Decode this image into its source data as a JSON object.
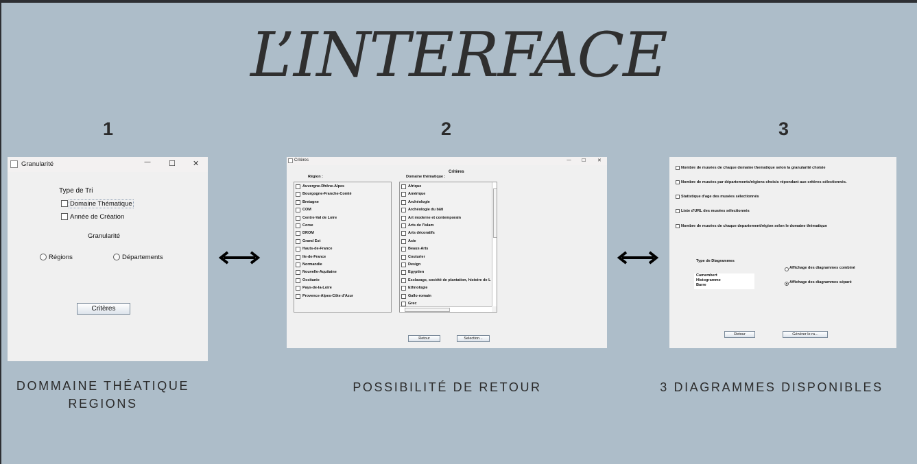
{
  "title": "L’INTERFACE",
  "sections": [
    {
      "number": "1",
      "caption_lines": [
        "DOMMAINE THÉATIQUE",
        "REGIONS"
      ]
    },
    {
      "number": "2",
      "caption_lines": [
        "POSSIBILITÉ DE RETOUR"
      ]
    },
    {
      "number": "3",
      "caption_lines": [
        "3 DIAGRAMMES DISPONIBLES"
      ]
    }
  ],
  "window1": {
    "title": "Granularité",
    "controls": {
      "minimize": "—",
      "maximize": "☐",
      "close": "✕"
    },
    "type_tri_label": "Type de Tri",
    "type_tri_options": [
      "Domaine Thématique",
      "Année de Création"
    ],
    "granularite_label": "Granularité",
    "granularite_options": [
      "Régions",
      "Départements"
    ],
    "button": "Critères"
  },
  "window2": {
    "title": "Critères",
    "controls": {
      "minimize": "—",
      "maximize": "☐",
      "close": "✕"
    },
    "heading": "Critères",
    "region_label": "Région :",
    "domaine_label": "Domaine thématique :",
    "regions": [
      "Auvergne-Rhône-Alpes",
      "Bourgogne-Franche-Comté",
      "Bretagne",
      "COM",
      "Centre-Val de Loire",
      "Corse",
      "DROM",
      "Grand Est",
      "Hauts-de-France",
      "Ile-de-France",
      "Normandie",
      "Nouvelle-Aquitaine",
      "Occitanie",
      "Pays-de-la-Loire",
      "Provence-Alpes-Côte d'Azur"
    ],
    "domaines": [
      "Afrique",
      "Amérique",
      "Archéologie",
      "Archéologie du bâti",
      "Art moderne et contemporain",
      "Arts de l'Islam",
      "Arts décoratifs",
      "Asie",
      "Beaux-Arts",
      "Couturier",
      "Design",
      "Egyptien",
      "Esclavage, société de plantation, histoire de L",
      "Ethnologie",
      "Gallo-romain",
      "Grec"
    ],
    "back_button": "Retour",
    "select_button": "Selection..."
  },
  "window3": {
    "options": [
      "Nombre de musées de chaque domaine thematique selon la granularité choisie",
      "Nombre de musées par départements/régions choisis répondant aux critères sélectionnés.",
      "Statistique d'age des musées sélectionnés",
      "Liste d'URL des musées sélectionnés",
      "Nombre de musées de chaque departement/région selon le domaine thématique"
    ],
    "diagram_type_label": "Type de Diagrammes",
    "diagram_types": [
      "Camembert",
      "Histogramme",
      "Barre"
    ],
    "display_options": [
      "Affichage des diagrammes combiné",
      "Affichage des diagrammes séparé"
    ],
    "back_button": "Retour",
    "generate_button": "Générer le ra..."
  }
}
